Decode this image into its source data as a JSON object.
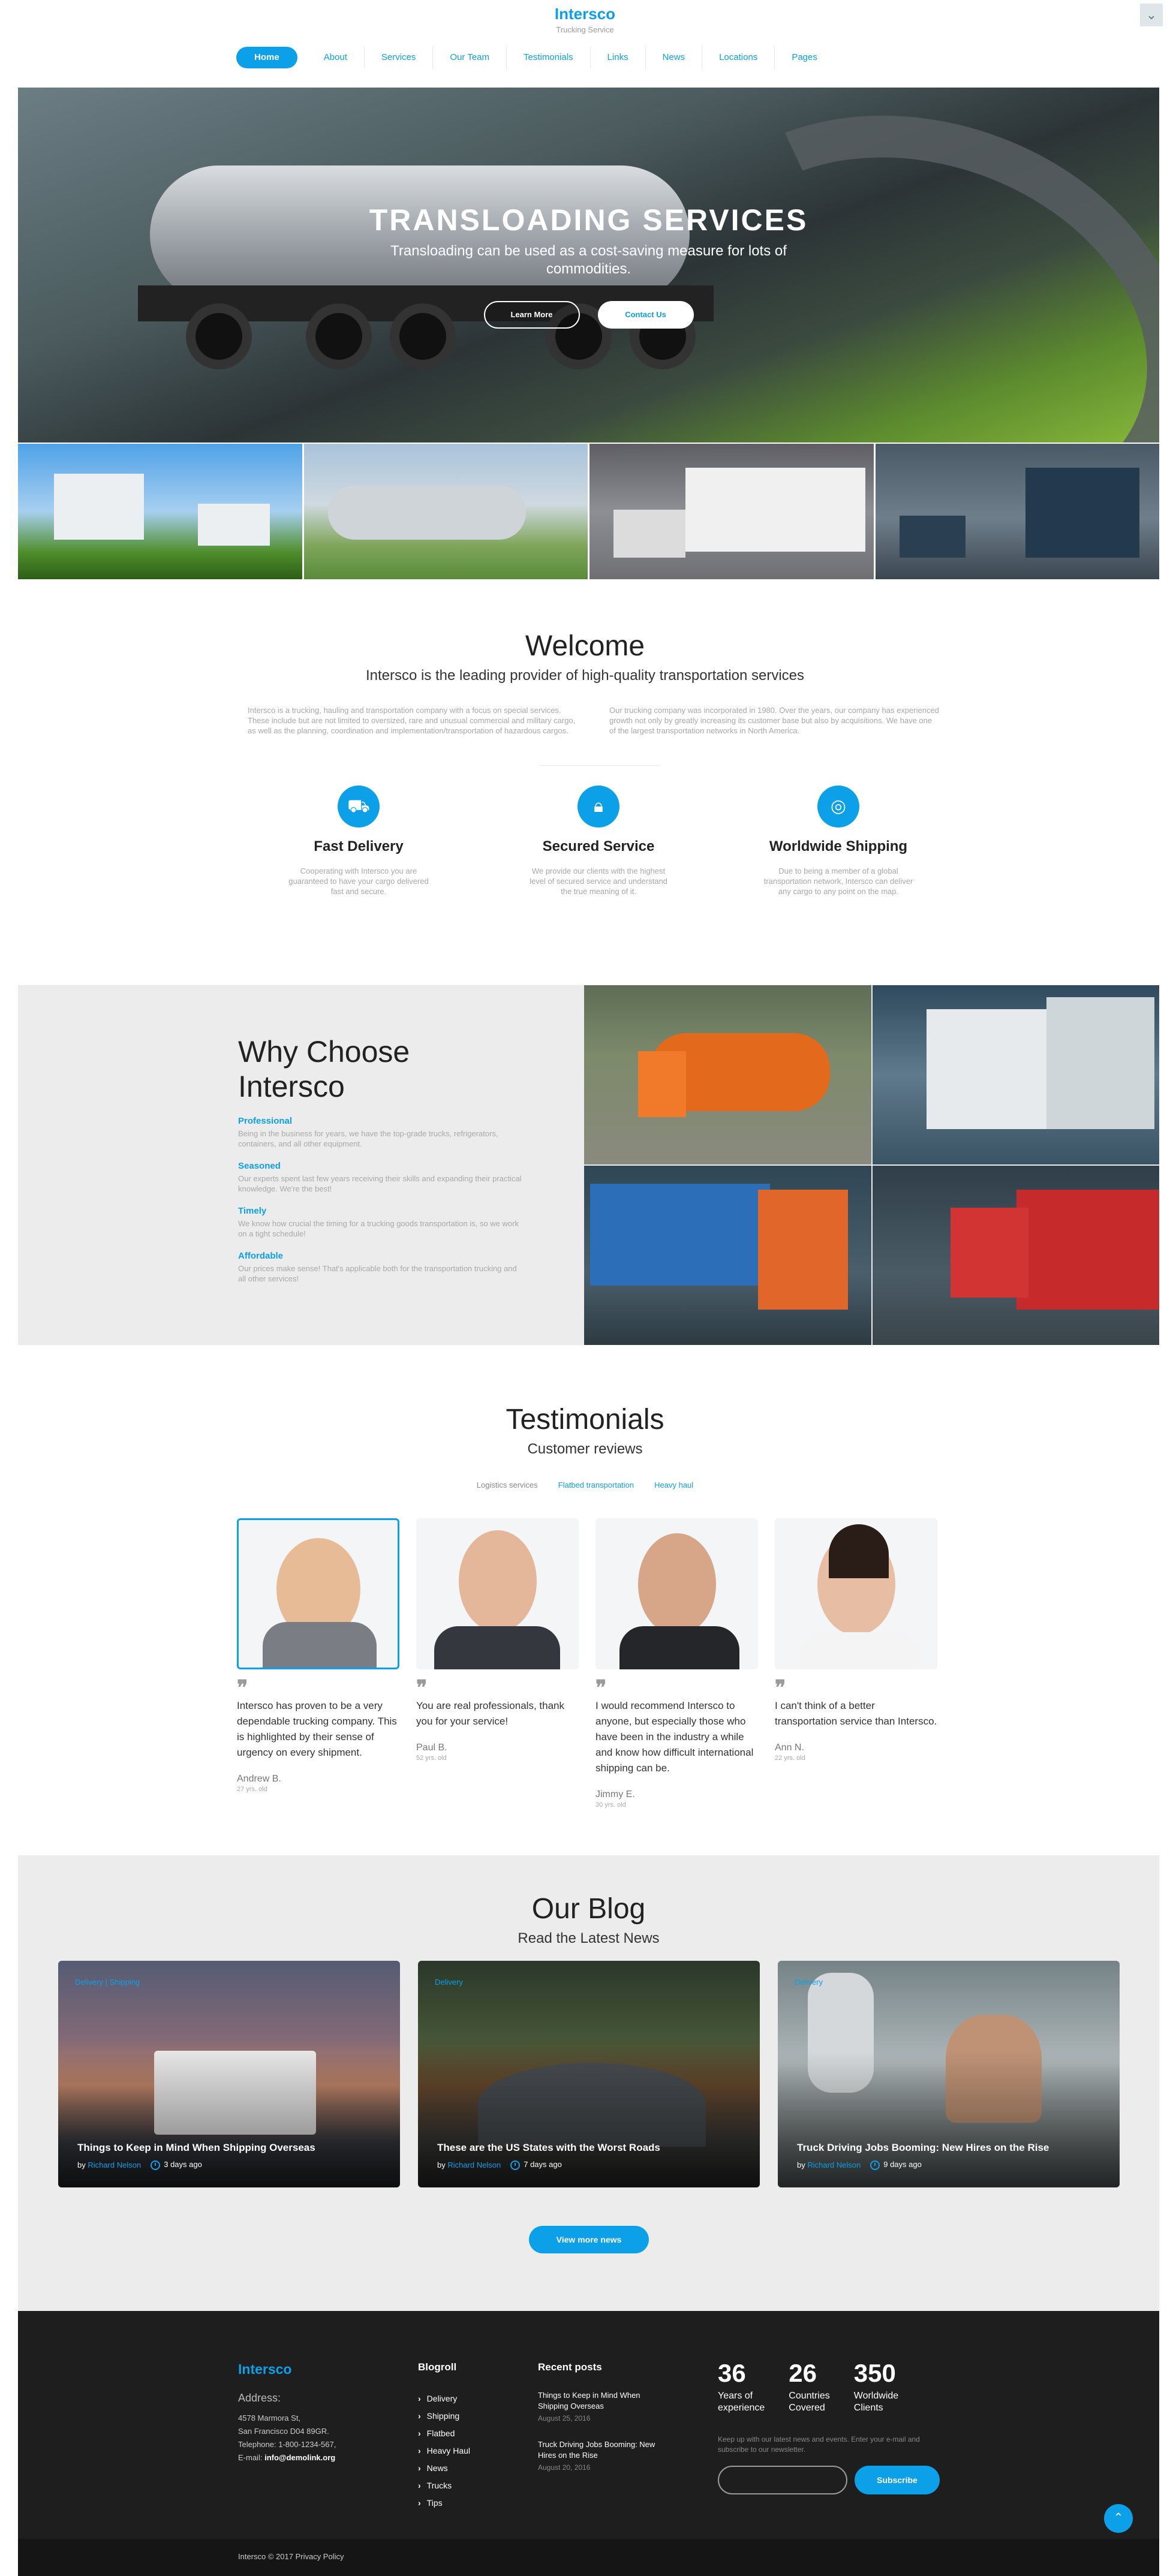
{
  "header": {
    "brand": "Intersco",
    "tagline": "Trucking Service",
    "nav": [
      "Home",
      "About",
      "Services",
      "Our Team",
      "Testimonials",
      "Links",
      "News",
      "Locations",
      "Pages"
    ]
  },
  "hero": {
    "title": "TRANSLOADING SERVICES",
    "subtitle": "Transloading can be used as a cost-saving measure for lots of commodities.",
    "btn_learn": "Learn More",
    "btn_contact": "Contact Us"
  },
  "welcome": {
    "title": "Welcome",
    "subtitle": "Intersco is the leading provider of high-quality transportation services",
    "col1": "Intersco is a trucking, hauling and transportation company with a focus on special services. These include but are not limited to oversized, rare and unusual commercial and military cargo, as well as the planning, coordination and implementation/transportation of hazardous cargos.",
    "col2": "Our trucking company was incorporated in 1980. Over the years, our company has experienced growth not only by greatly increasing its customer base but also by acquisitions. We have one of the largest transportation networks in North America.",
    "features": [
      {
        "icon": "truck-icon",
        "title": "Fast Delivery",
        "text": "Cooperating with Intersco you are guaranteed to have your cargo delivered fast and secure."
      },
      {
        "icon": "lock-icon",
        "title": "Secured Service",
        "text": "We provide our clients with the highest level of secured service and understand the true meaning of it."
      },
      {
        "icon": "globe-icon",
        "title": "Worldwide Shipping",
        "text": "Due to being a member of a global transportation network, Intersco can deliver any cargo to any point on the map."
      }
    ]
  },
  "why": {
    "title_line1": "Why Choose",
    "title_line2": "Intersco",
    "items": [
      {
        "title": "Professional",
        "text": "Being in the business for years, we have the top-grade trucks, refrigerators, containers, and all other equipment."
      },
      {
        "title": "Seasoned",
        "text": "Our experts spent last few years receiving their skills and expanding their practical knowledge. We're the best!"
      },
      {
        "title": "Timely",
        "text": "We know how crucial the timing for a trucking goods transportation is, so we work on a tight schedule!"
      },
      {
        "title": "Affordable",
        "text": "Our prices make sense! That's applicable both for the transportation trucking and all other services!"
      }
    ]
  },
  "testimonials": {
    "title": "Testimonials",
    "subtitle": "Customer reviews",
    "tabs": [
      "Logistics services",
      "Flatbed transportation",
      "Heavy haul"
    ],
    "reviews": [
      {
        "quote": "Intersco has proven to be a very dependable trucking company. This is highlighted by their sense of urgency on every shipment.",
        "name": "Andrew B.",
        "age": "27 yrs. old"
      },
      {
        "quote": "You are real professionals, thank you for your service!",
        "name": "Paul B.",
        "age": "52 yrs. old"
      },
      {
        "quote": "I would recommend Intersco to anyone, but especially those who have been in the industry a while and know how difficult international shipping can be.",
        "name": "Jimmy E.",
        "age": "30 yrs. old"
      },
      {
        "quote": "I can't think of a better transportation service than Intersco.",
        "name": "Ann N.",
        "age": "22 yrs. old"
      }
    ]
  },
  "blog": {
    "title": "Our Blog",
    "subtitle": "Read the Latest News",
    "posts": [
      {
        "tags": "Delivery  |  Shipping",
        "title": "Things to Keep in Mind When Shipping Overseas",
        "by": "by",
        "author": "Richard Nelson",
        "time": "3 days ago"
      },
      {
        "tags": "Delivery",
        "title": "These are the US States with the Worst Roads",
        "by": "by",
        "author": "Richard Nelson",
        "time": "7 days ago"
      },
      {
        "tags": "Delivery",
        "title": "Truck Driving Jobs Booming: New Hires on the Rise",
        "by": "by",
        "author": "Richard Nelson",
        "time": "9 days ago"
      }
    ],
    "more_btn": "View more news"
  },
  "footer": {
    "brand": "Intersco",
    "address_label": "Address:",
    "address_line1": "4578 Marmora St,",
    "address_line2": "San Francisco D04 89GR.",
    "telephone": "Telephone: 1-800-1234-567,",
    "email_label": "E-mail:",
    "email": "info@demolink.org",
    "blogroll_title": "Blogroll",
    "blogroll": [
      "Delivery",
      "Shipping",
      "Flatbed",
      "Heavy Haul",
      "News",
      "Trucks",
      "Tips"
    ],
    "recent_title": "Recent posts",
    "recent": [
      {
        "title": "Things to Keep in Mind When Shipping Overseas",
        "date": "August 25, 2016"
      },
      {
        "title": "Truck Driving Jobs Booming: New Hires on the Rise",
        "date": "August 20, 2016"
      }
    ],
    "stats": [
      {
        "num": "36",
        "line1": "Years of",
        "line2": "experience"
      },
      {
        "num": "26",
        "line1": "Countries",
        "line2": "Covered"
      },
      {
        "num": "350",
        "line1": "Worldwide",
        "line2": "Clients"
      }
    ],
    "newsletter_text": "Keep up with our latest news and events. Enter your e-mail and subscribe to our newsletter.",
    "subscribe_btn": "Subscribe",
    "copyright": "Intersco © 2017 Privacy Policy"
  },
  "colors": {
    "accent": "#0ca0e8",
    "footer_bg": "#1e1e1e",
    "section_gray": "#ececec"
  }
}
